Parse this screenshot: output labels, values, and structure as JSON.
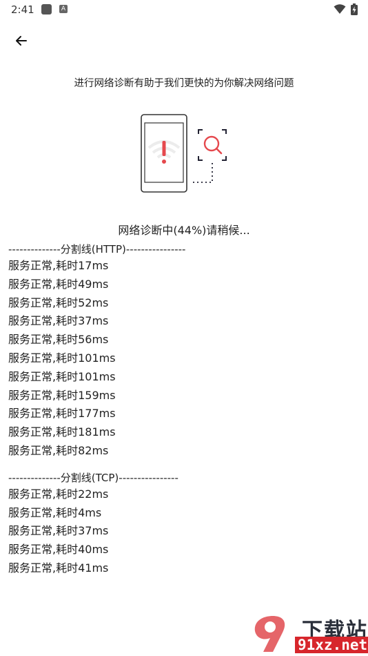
{
  "status_bar": {
    "time": "2:41",
    "icons": [
      "app-icon",
      "a-icon",
      "wifi-icon",
      "battery-charging-icon"
    ],
    "a_label": "A"
  },
  "header": {
    "back_icon": "arrow-left-icon"
  },
  "intro_text": "进行网络诊断有助于我们更快的为你解决网络问题",
  "illustration": {
    "icons": [
      "phone-icon",
      "wifi-warning-icon",
      "magnifier-scan-icon"
    ],
    "accent_color": "#e5484d"
  },
  "progress_text": "网络诊断中(44%)请稍候...",
  "diagnosis_progress_percent": 44,
  "http_section": {
    "divider": "--------------分割线(HTTP)----------------",
    "rows": [
      "服务正常,耗时17ms",
      "服务正常,耗时49ms",
      "服务正常,耗时52ms",
      "服务正常,耗时37ms",
      "服务正常,耗时56ms",
      "服务正常,耗时101ms",
      "服务正常,耗时101ms",
      "服务正常,耗时159ms",
      "服务正常,耗时177ms",
      "服务正常,耗时181ms",
      "服务正常,耗时82ms"
    ]
  },
  "tcp_section": {
    "divider": "--------------分割线(TCP)----------------",
    "rows": [
      "服务正常,耗时22ms",
      "服务正常,耗时4ms",
      "服务正常,耗时37ms",
      "服务正常,耗时40ms",
      "服务正常,耗时41ms"
    ]
  },
  "watermark": {
    "top": "下载站",
    "bottom": "91xz.net",
    "brand_color": "#d7262c"
  }
}
